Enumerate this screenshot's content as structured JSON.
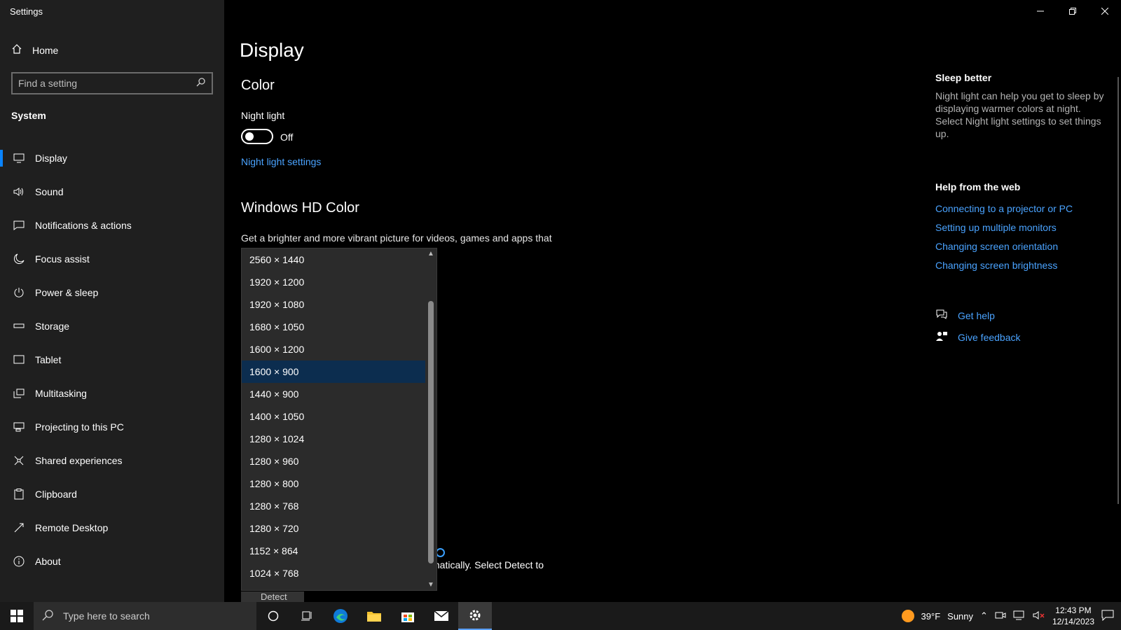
{
  "window": {
    "title": "Settings"
  },
  "sidebar": {
    "home_label": "Home",
    "search_placeholder": "Find a setting",
    "section_label": "System",
    "items": [
      {
        "label": "Display",
        "icon": "monitor-icon"
      },
      {
        "label": "Sound",
        "icon": "speaker-icon"
      },
      {
        "label": "Notifications & actions",
        "icon": "notification-icon"
      },
      {
        "label": "Focus assist",
        "icon": "moon-icon"
      },
      {
        "label": "Power & sleep",
        "icon": "power-icon"
      },
      {
        "label": "Storage",
        "icon": "storage-icon"
      },
      {
        "label": "Tablet",
        "icon": "tablet-icon"
      },
      {
        "label": "Multitasking",
        "icon": "multitasking-icon"
      },
      {
        "label": "Projecting to this PC",
        "icon": "projector-icon"
      },
      {
        "label": "Shared experiences",
        "icon": "shared-icon"
      },
      {
        "label": "Clipboard",
        "icon": "clipboard-icon"
      },
      {
        "label": "Remote Desktop",
        "icon": "remote-desktop-icon"
      },
      {
        "label": "About",
        "icon": "info-icon"
      }
    ]
  },
  "main": {
    "title": "Display",
    "color_heading": "Color",
    "night_light_label": "Night light",
    "night_light_state": "Off",
    "night_light_link": "Night light settings",
    "hd_heading": "Windows HD Color",
    "hd_description": "Get a brighter and more vibrant picture for videos, games and apps that",
    "partial_text": "matically. Select Detect to",
    "detect_label": "Detect"
  },
  "resolution_dropdown": {
    "options": [
      "2560 × 1440",
      "1920 × 1200",
      "1920 × 1080",
      "1680 × 1050",
      "1600 × 1200",
      "1600 × 900",
      "1440 × 900",
      "1400 × 1050",
      "1280 × 1024",
      "1280 × 960",
      "1280 × 800",
      "1280 × 768",
      "1280 × 720",
      "1152 × 864",
      "1024 × 768"
    ],
    "selected": "1600 × 900"
  },
  "right_pane": {
    "sleep_heading": "Sleep better",
    "sleep_text": "Night light can help you get to sleep by displaying warmer colors at night. Select Night light settings to set things up.",
    "help_heading": "Help from the web",
    "help_links": [
      "Connecting to a projector or PC",
      "Setting up multiple monitors",
      "Changing screen orientation",
      "Changing screen brightness"
    ],
    "get_help": "Get help",
    "give_feedback": "Give feedback"
  },
  "taskbar": {
    "search_placeholder": "Type here to search",
    "weather_temp": "39°F",
    "weather_text": "Sunny",
    "time": "12:43 PM",
    "date": "12/14/2023"
  },
  "colors": {
    "accent": "#0a84ff",
    "link": "#4aa3ff",
    "selected_option": "#0c2d4f"
  }
}
